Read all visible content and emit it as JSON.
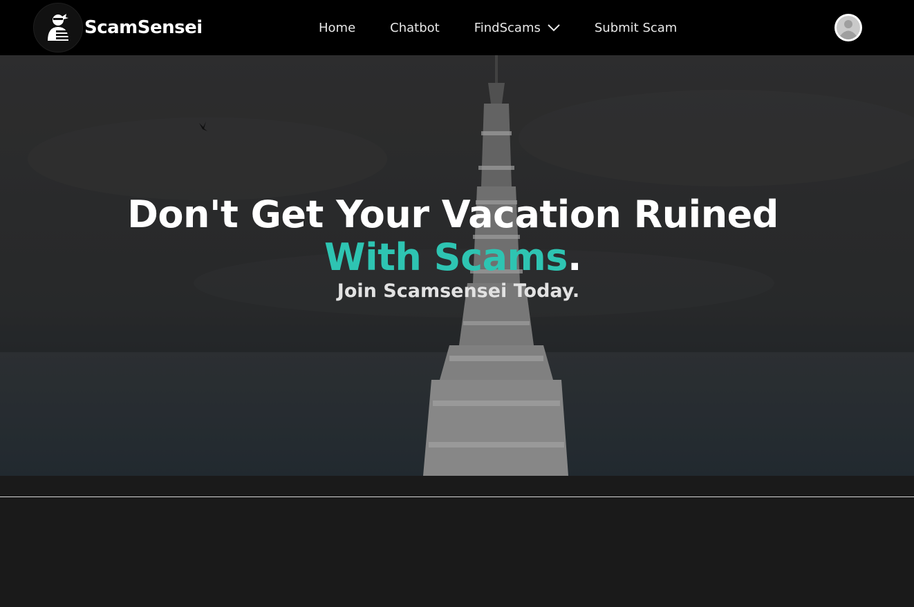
{
  "brand": {
    "name": "ScamSensei",
    "logo_icon": "ninja-logo-icon"
  },
  "nav": {
    "items": [
      {
        "label": "Home"
      },
      {
        "label": "Chatbot"
      },
      {
        "label": "FindScams",
        "icon": "chevron-down-icon"
      },
      {
        "label": "Submit Scam"
      }
    ]
  },
  "user": {
    "avatar_icon": "user-avatar-icon"
  },
  "hero": {
    "title_line1": "Don't Get Your Vacation Ruined",
    "title_line2_accent": "With Scams",
    "title_line2_end": ".",
    "subtitle": "Join Scamsensei Today."
  },
  "colors": {
    "navbar_bg": "#000000",
    "accent": "#2ec4b2",
    "page_bg": "#1a1a1a",
    "text": "#ffffff"
  }
}
